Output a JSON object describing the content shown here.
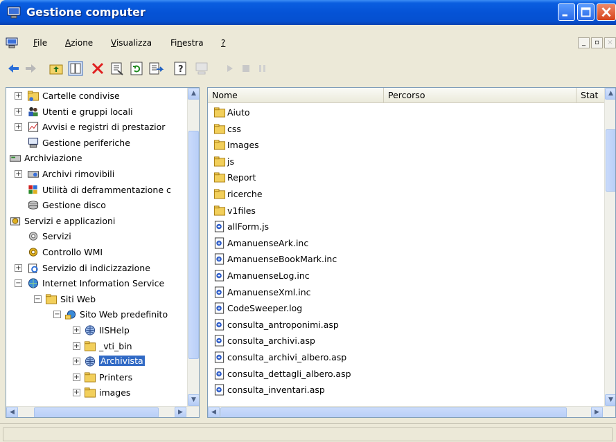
{
  "window": {
    "title": "Gestione computer"
  },
  "menu": {
    "items": [
      {
        "label": "File",
        "key": "F",
        "rest": "ile"
      },
      {
        "label": "Azione",
        "key": "A",
        "rest": "zione"
      },
      {
        "label": "Visualizza",
        "key": "V",
        "rest": "isualizza"
      },
      {
        "label": "Finestra",
        "pre": "Fi",
        "key": "n",
        "rest": "estra"
      },
      {
        "label": "?",
        "key": "?",
        "rest": ""
      }
    ]
  },
  "tree": {
    "items": [
      {
        "label": "Cartelle condivise",
        "icon": "shared-folder-icon",
        "expander": "+"
      },
      {
        "label": "Utenti e gruppi locali",
        "icon": "users-groups-icon",
        "expander": "+"
      },
      {
        "label": "Avvisi e registri di prestazior",
        "icon": "performance-logs-icon",
        "expander": "+"
      },
      {
        "label": "Gestione periferiche",
        "icon": "device-manager-icon",
        "expander": ""
      },
      {
        "label": "Archiviazione",
        "icon": "storage-icon",
        "expander": "-"
      },
      {
        "label": "Archivi rimovibili",
        "icon": "removable-storage-icon",
        "expander": "+"
      },
      {
        "label": "Utilità di deframmentazione c",
        "icon": "defrag-icon",
        "expander": ""
      },
      {
        "label": "Gestione disco",
        "icon": "disk-management-icon",
        "expander": ""
      },
      {
        "label": "Servizi e applicazioni",
        "icon": "services-apps-icon",
        "expander": "-"
      },
      {
        "label": "Servizi",
        "icon": "services-icon",
        "expander": ""
      },
      {
        "label": "Controllo WMI",
        "icon": "wmi-icon",
        "expander": ""
      },
      {
        "label": "Servizio di indicizzazione",
        "icon": "indexing-icon",
        "expander": "+"
      },
      {
        "label": "Internet Information Service",
        "icon": "iis-icon",
        "expander": "-"
      },
      {
        "label": "Siti Web",
        "icon": "folder-icon",
        "expander": "-"
      },
      {
        "label": "Sito Web predefinito",
        "icon": "website-icon",
        "expander": "-"
      },
      {
        "label": "IISHelp",
        "icon": "virtual-dir-icon",
        "expander": "+"
      },
      {
        "label": "_vti_bin",
        "icon": "folder-icon",
        "expander": "+"
      },
      {
        "label": "Archivista",
        "icon": "virtual-dir-icon",
        "expander": "+",
        "selected": true
      },
      {
        "label": "Printers",
        "icon": "folder-icon",
        "expander": "+"
      },
      {
        "label": "images",
        "icon": "folder-icon",
        "expander": "+"
      }
    ]
  },
  "list": {
    "columns": [
      "Nome",
      "Percorso",
      "Stat"
    ],
    "files": [
      {
        "name": "Aiuto",
        "type": "folder"
      },
      {
        "name": "css",
        "type": "folder"
      },
      {
        "name": "Images",
        "type": "folder"
      },
      {
        "name": "js",
        "type": "folder"
      },
      {
        "name": "Report",
        "type": "folder"
      },
      {
        "name": "ricerche",
        "type": "folder"
      },
      {
        "name": "v1files",
        "type": "folder"
      },
      {
        "name": "allForm.js",
        "type": "file"
      },
      {
        "name": "AmanuenseArk.inc",
        "type": "file"
      },
      {
        "name": "AmanuenseBookMark.inc",
        "type": "file"
      },
      {
        "name": "AmanuenseLog.inc",
        "type": "file"
      },
      {
        "name": "AmanuenseXml.inc",
        "type": "file"
      },
      {
        "name": "CodeSweeper.log",
        "type": "file"
      },
      {
        "name": "consulta_antroponimi.asp",
        "type": "file"
      },
      {
        "name": "consulta_archivi.asp",
        "type": "file"
      },
      {
        "name": "consulta_archivi_albero.asp",
        "type": "file"
      },
      {
        "name": "consulta_dettagli_albero.asp",
        "type": "file"
      },
      {
        "name": "consulta_inventari.asp",
        "type": "file"
      }
    ]
  }
}
